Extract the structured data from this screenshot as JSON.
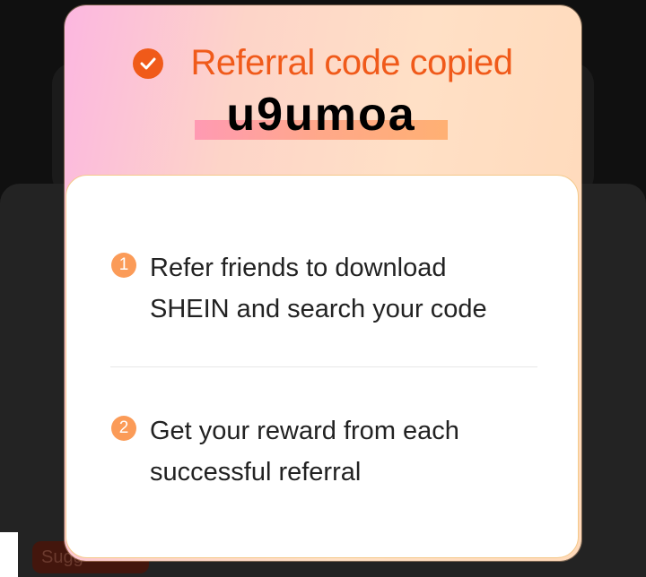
{
  "dialog": {
    "title": "Referral code copied",
    "code": "u9umoa",
    "check_icon": "check-circle-icon",
    "accent_color": "#f05a1a",
    "steps": [
      {
        "number": "1",
        "text_line1": "Refer friends to download",
        "text_line2": "SHEIN and search your code"
      },
      {
        "number": "2",
        "text_line1": "Get your reward from each",
        "text_line2": "successful referral"
      }
    ]
  },
  "background": {
    "pill_label": "Sugg"
  }
}
